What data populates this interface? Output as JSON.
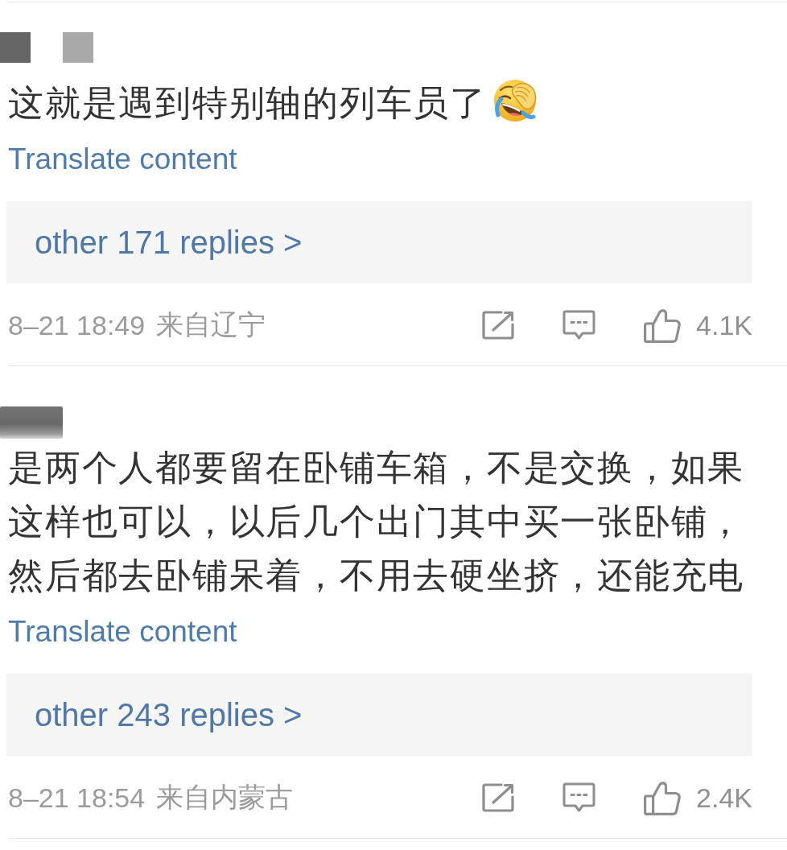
{
  "comments": [
    {
      "author": {
        "kind": "blocks"
      },
      "text": "这就是遇到特别轴的列车员了",
      "trailing_emoji": true,
      "translate_link": "Translate content",
      "replies_link": "other 171 replies >",
      "time": "8–21 18:49",
      "location": "来自辽宁",
      "likes": "4.1K"
    },
    {
      "author": {
        "kind": "blur"
      },
      "text": "是两个人都要留在卧铺车箱，不是交换，如果这样也可以，以后几个出门其中买一张卧铺，然后都去卧铺呆着，不用去硬坐挤，还能充电",
      "translate_link": "Translate content",
      "replies_link": "other 243 replies >",
      "time": "8–21 18:54",
      "location": "来自内蒙古",
      "likes": "2.4K"
    }
  ]
}
